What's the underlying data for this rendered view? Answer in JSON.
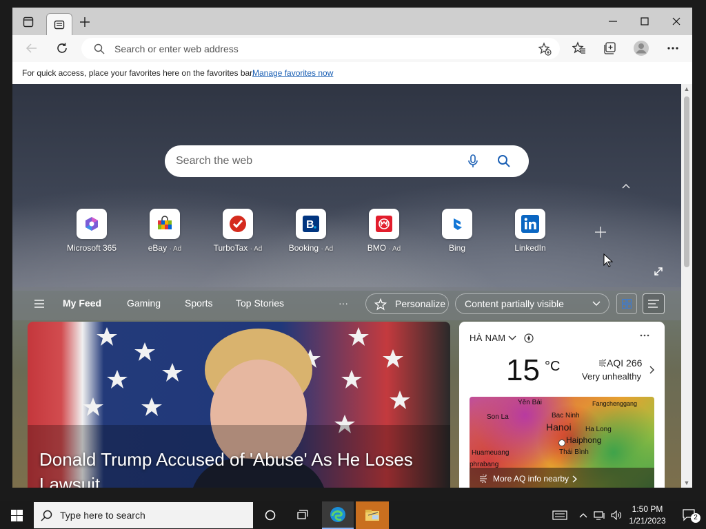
{
  "browser": {
    "address_placeholder": "Search or enter web address",
    "favorites_bar": {
      "message": "For quick access, place your favorites here on the favorites bar.",
      "link": "Manage favorites now"
    }
  },
  "newtab": {
    "search_placeholder": "Search the web",
    "quick_links": [
      {
        "name": "Microsoft 365",
        "ad": ""
      },
      {
        "name": "eBay",
        "ad": "· Ad"
      },
      {
        "name": "TurboTax",
        "ad": "· Ad"
      },
      {
        "name": "Booking",
        "ad": "· Ad"
      },
      {
        "name": "BMO",
        "ad": "· Ad"
      },
      {
        "name": "Bing",
        "ad": ""
      },
      {
        "name": "LinkedIn",
        "ad": ""
      }
    ],
    "feed_nav": {
      "items": [
        "My Feed",
        "Gaming",
        "Sports",
        "Top Stories"
      ],
      "more": "···",
      "personalize": "Personalize",
      "visibility": "Content partially visible"
    },
    "hero": {
      "headline": "Donald Trump Accused of 'Abuse' As He Loses Lawsuit"
    },
    "weather": {
      "location": "HÀ NAM",
      "temperature": "15",
      "unit": "°C",
      "aqi": "AQI 266",
      "aqi_desc": "Very unhealthy",
      "map_labels": [
        "Yên Bái",
        "Fangchenggang",
        "Son La",
        "Bac Ninh",
        "Hanoi",
        "Ha Long",
        "Haiphong",
        "Huameuang",
        "Thái Bình",
        "phrabang"
      ],
      "more_link": "More AQ info nearby"
    }
  },
  "taskbar": {
    "search_placeholder": "Type here to search",
    "time": "1:50 PM",
    "date": "1/21/2023",
    "notification_count": "2"
  }
}
